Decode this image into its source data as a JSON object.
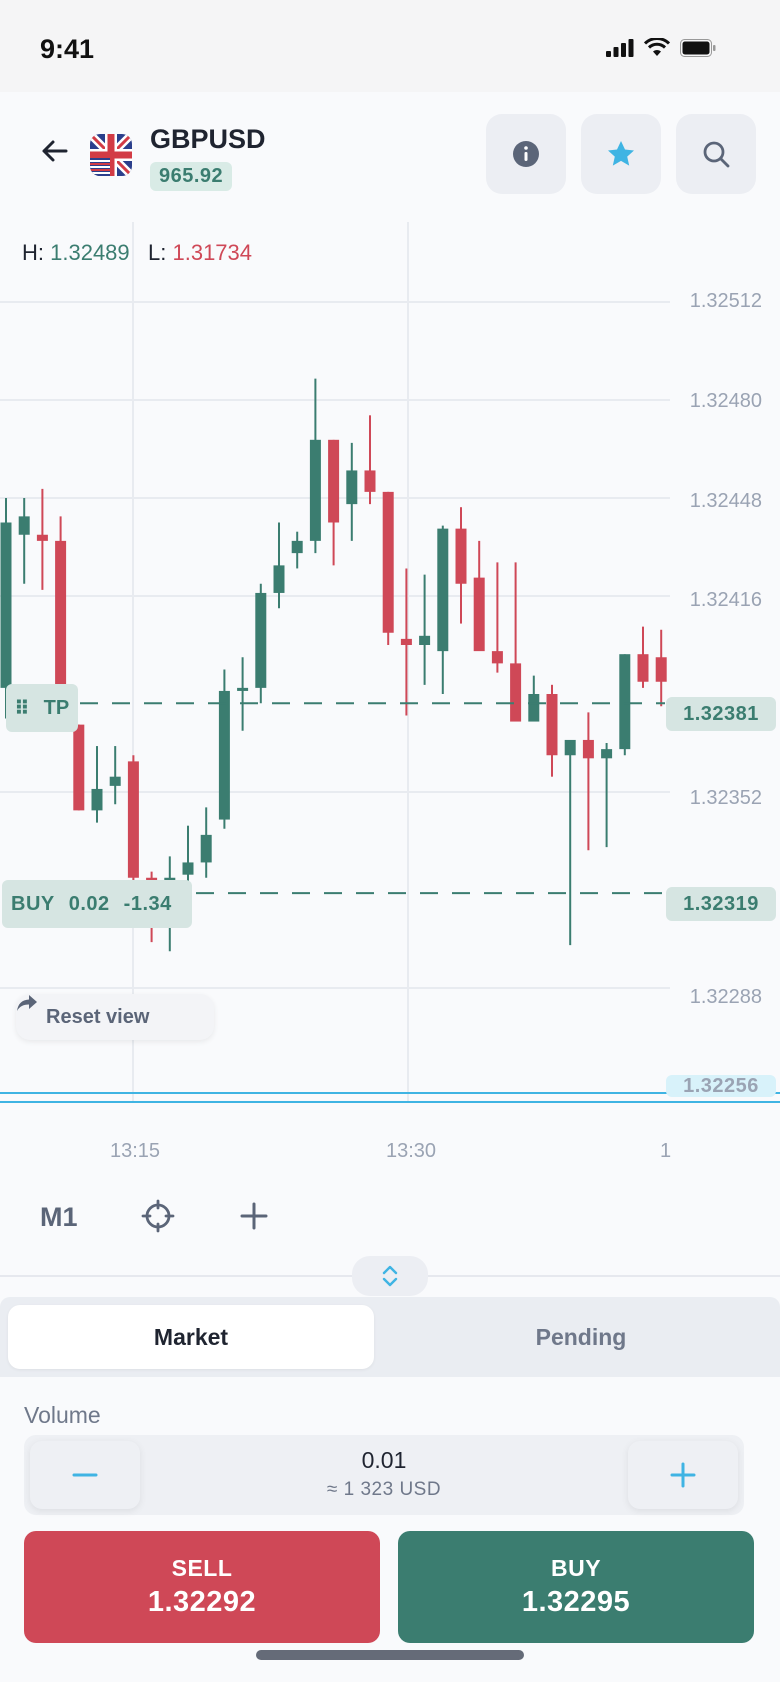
{
  "status": {
    "time": "9:41"
  },
  "header": {
    "symbol": "GBPUSD",
    "price_badge": "965.92",
    "back_icon": "arrow-left-icon",
    "info_icon": "info-icon",
    "favorite_icon": "star-icon",
    "search_icon": "search-icon"
  },
  "chart_data": {
    "type": "candlestick",
    "high_label": "H:",
    "high_value": "1.32489",
    "low_label": "L:",
    "low_value": "1.31734",
    "y_ticks": [
      "1.32512",
      "1.32480",
      "1.32448",
      "1.32416",
      "1.32352",
      "1.32288",
      "1.32256"
    ],
    "x_ticks": [
      "13:15",
      "13:30",
      "1"
    ],
    "tp_line": {
      "label": "TP",
      "price": "1.32381"
    },
    "position_line": {
      "side": "BUY",
      "volume": "0.02",
      "pnl": "-1.34",
      "price": "1.32319"
    },
    "current_price": "1.32256",
    "candles": [
      {
        "o": 1.32386,
        "h": 1.32448,
        "l": 1.32376,
        "c": 1.3244
      },
      {
        "o": 1.32436,
        "h": 1.32448,
        "l": 1.3242,
        "c": 1.32442
      },
      {
        "o": 1.32436,
        "h": 1.32451,
        "l": 1.32418,
        "c": 1.32434
      },
      {
        "o": 1.32434,
        "h": 1.32442,
        "l": 1.32372,
        "c": 1.32374
      },
      {
        "o": 1.32374,
        "h": 1.32374,
        "l": 1.32346,
        "c": 1.32346
      },
      {
        "o": 1.32346,
        "h": 1.32367,
        "l": 1.32342,
        "c": 1.32353
      },
      {
        "o": 1.32354,
        "h": 1.32367,
        "l": 1.32348,
        "c": 1.32357
      },
      {
        "o": 1.32362,
        "h": 1.32364,
        "l": 1.32311,
        "c": 1.32324
      },
      {
        "o": 1.32324,
        "h": 1.32326,
        "l": 1.32303,
        "c": 1.32321
      },
      {
        "o": 1.32322,
        "h": 1.32331,
        "l": 1.323,
        "c": 1.32324
      },
      {
        "o": 1.32325,
        "h": 1.32341,
        "l": 1.32321,
        "c": 1.32329
      },
      {
        "o": 1.32329,
        "h": 1.32347,
        "l": 1.32324,
        "c": 1.32338
      },
      {
        "o": 1.32343,
        "h": 1.32392,
        "l": 1.3234,
        "c": 1.32385
      },
      {
        "o": 1.32385,
        "h": 1.32396,
        "l": 1.32372,
        "c": 1.32386
      },
      {
        "o": 1.32386,
        "h": 1.3242,
        "l": 1.32381,
        "c": 1.32417
      },
      {
        "o": 1.32417,
        "h": 1.3244,
        "l": 1.32412,
        "c": 1.32426
      },
      {
        "o": 1.3243,
        "h": 1.32437,
        "l": 1.32425,
        "c": 1.32434
      },
      {
        "o": 1.32434,
        "h": 1.32487,
        "l": 1.3243,
        "c": 1.32467
      },
      {
        "o": 1.32467,
        "h": 1.32467,
        "l": 1.32426,
        "c": 1.3244
      },
      {
        "o": 1.32446,
        "h": 1.32466,
        "l": 1.32434,
        "c": 1.32457
      },
      {
        "o": 1.32457,
        "h": 1.32475,
        "l": 1.32446,
        "c": 1.3245
      },
      {
        "o": 1.3245,
        "h": 1.3245,
        "l": 1.324,
        "c": 1.32404
      },
      {
        "o": 1.32402,
        "h": 1.32425,
        "l": 1.32377,
        "c": 1.324
      },
      {
        "o": 1.324,
        "h": 1.32423,
        "l": 1.32387,
        "c": 1.32403
      },
      {
        "o": 1.32398,
        "h": 1.32439,
        "l": 1.32384,
        "c": 1.32438
      },
      {
        "o": 1.32438,
        "h": 1.32445,
        "l": 1.32407,
        "c": 1.3242
      },
      {
        "o": 1.32422,
        "h": 1.32434,
        "l": 1.32401,
        "c": 1.32398
      },
      {
        "o": 1.32398,
        "h": 1.32427,
        "l": 1.32391,
        "c": 1.32394
      },
      {
        "o": 1.32394,
        "h": 1.32427,
        "l": 1.3238,
        "c": 1.32375
      },
      {
        "o": 1.32375,
        "h": 1.3239,
        "l": 1.32378,
        "c": 1.32384
      },
      {
        "o": 1.32384,
        "h": 1.32387,
        "l": 1.32357,
        "c": 1.32364
      },
      {
        "o": 1.32364,
        "h": 1.32367,
        "l": 1.32302,
        "c": 1.32369
      },
      {
        "o": 1.32369,
        "h": 1.32378,
        "l": 1.32333,
        "c": 1.32363
      },
      {
        "o": 1.32363,
        "h": 1.32368,
        "l": 1.32334,
        "c": 1.32366
      },
      {
        "o": 1.32366,
        "h": 1.32397,
        "l": 1.32364,
        "c": 1.32397
      },
      {
        "o": 1.32397,
        "h": 1.32406,
        "l": 1.32386,
        "c": 1.32388
      },
      {
        "o": 1.32396,
        "h": 1.32405,
        "l": 1.3238,
        "c": 1.32388
      }
    ],
    "colors": {
      "up": "#3b7d70",
      "down": "#cf4857"
    }
  },
  "chart_controls": {
    "reset_view": "Reset view",
    "timeframe": "M1"
  },
  "order": {
    "tabs": [
      "Market",
      "Pending"
    ],
    "volume_label": "Volume",
    "volume_value": "0.01",
    "volume_approx": "≈ 1 323 USD",
    "sell_label": "SELL",
    "sell_price": "1.32292",
    "buy_label": "BUY",
    "buy_price": "1.32295"
  }
}
